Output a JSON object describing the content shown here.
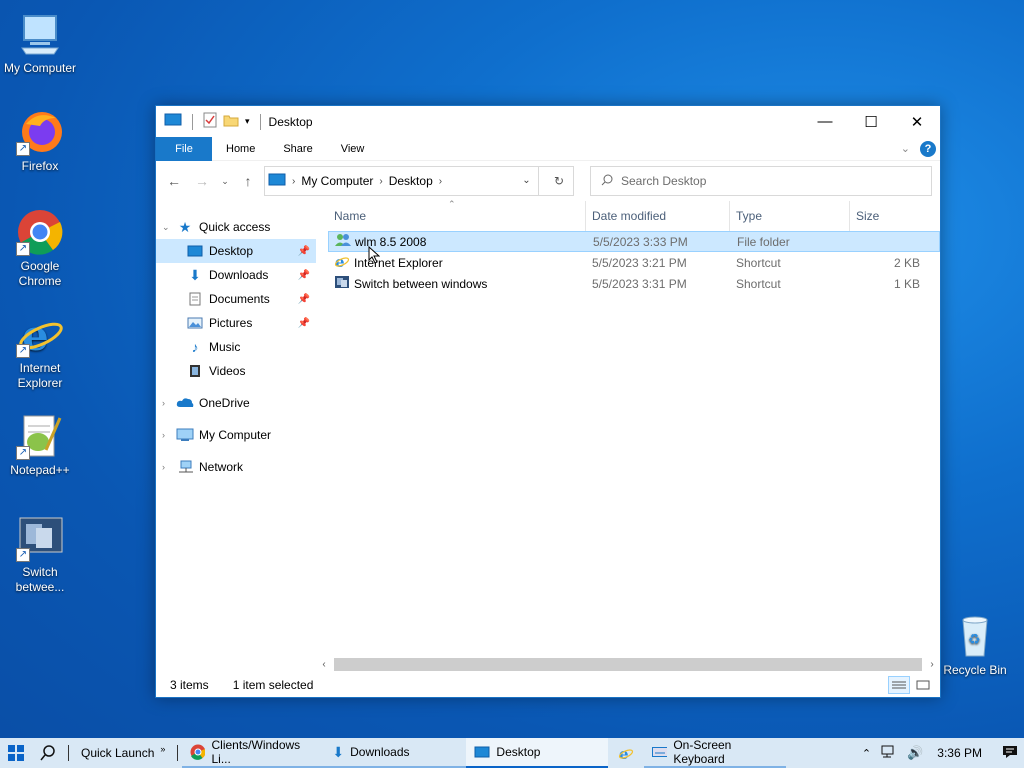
{
  "desktop": {
    "icons": [
      {
        "label": "My Computer",
        "icon": "computer-icon"
      },
      {
        "label": "Firefox",
        "icon": "firefox-icon"
      },
      {
        "label": "Google Chrome",
        "icon": "chrome-icon"
      },
      {
        "label": "Internet Explorer",
        "icon": "ie-icon"
      },
      {
        "label": "Notepad++",
        "icon": "notepadpp-icon"
      },
      {
        "label": "Switch betwee...",
        "icon": "switch-windows-icon"
      },
      {
        "label": "Recycle Bin",
        "icon": "recycle-bin-icon"
      }
    ]
  },
  "window": {
    "title": "Desktop",
    "ribbon_tabs": [
      "File",
      "Home",
      "Share",
      "View"
    ],
    "address": {
      "segments": [
        "My Computer",
        "Desktop"
      ]
    },
    "search_placeholder": "Search Desktop",
    "nav": {
      "quick_access": "Quick access",
      "items": [
        "Desktop",
        "Downloads",
        "Documents",
        "Pictures",
        "Music",
        "Videos"
      ],
      "onedrive": "OneDrive",
      "my_computer": "My Computer",
      "network": "Network"
    },
    "columns": {
      "name": "Name",
      "date": "Date modified",
      "type": "Type",
      "size": "Size"
    },
    "files": [
      {
        "name": "wlm 8.5 2008",
        "date": "5/5/2023 3:33 PM",
        "type": "File folder",
        "size": ""
      },
      {
        "name": "Internet Explorer",
        "date": "5/5/2023 3:21 PM",
        "type": "Shortcut",
        "size": "2 KB"
      },
      {
        "name": "Switch between windows",
        "date": "5/5/2023 3:31 PM",
        "type": "Shortcut",
        "size": "1 KB"
      }
    ],
    "status": {
      "count": "3 items",
      "selected": "1 item selected"
    }
  },
  "taskbar": {
    "quick_launch": "Quick Launch",
    "chrome_task": "Clients/Windows Li...",
    "downloads_task": "Downloads",
    "desktop_task": "Desktop",
    "osk_task": "On-Screen Keyboard",
    "clock": "3:36 PM"
  },
  "colors": {
    "accent": "#1979ca",
    "selection": "#cce8ff",
    "taskbar": "#d9e8f5"
  }
}
